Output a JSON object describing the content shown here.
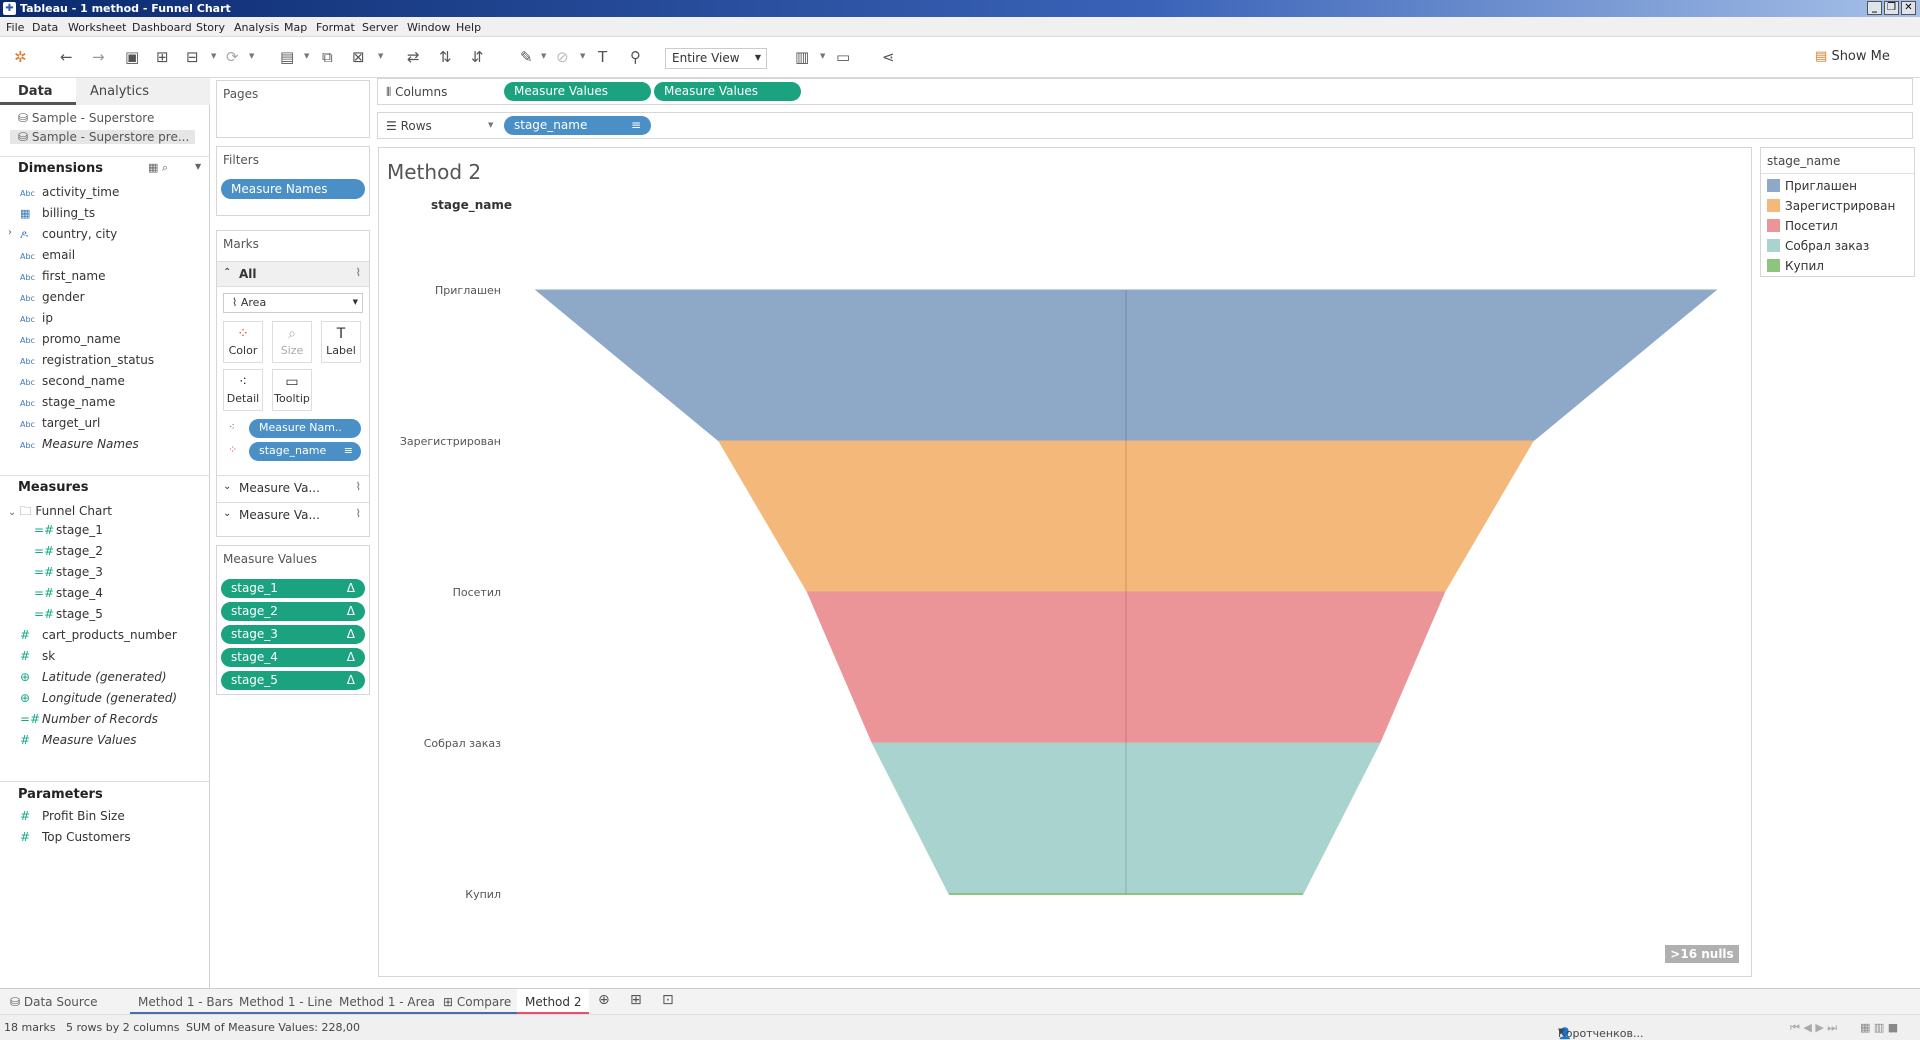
{
  "window": {
    "title": "Tableau - 1 method - Funnel Chart"
  },
  "menu": [
    "File",
    "Data",
    "Worksheet",
    "Dashboard",
    "Story",
    "Analysis",
    "Map",
    "Format",
    "Server",
    "Window",
    "Help"
  ],
  "toolbar": {
    "fit": "Entire View",
    "show_me": "Show Me"
  },
  "data_pane": {
    "tabs": [
      "Data",
      "Analytics"
    ],
    "datasources": [
      "Sample - Superstore",
      "Sample - Superstore pre..."
    ],
    "dimensions_title": "Dimensions",
    "dimensions": [
      "activity_time",
      "billing_ts",
      "country, city",
      "email",
      "first_name",
      "gender",
      "ip",
      "promo_name",
      "registration_status",
      "second_name",
      "stage_name",
      "target_url",
      "Measure Names"
    ],
    "measures_title": "Measures",
    "folder": "Funnel Chart",
    "folder_items": [
      "stage_1",
      "stage_2",
      "stage_3",
      "stage_4",
      "stage_5"
    ],
    "measures": [
      "cart_products_number",
      "sk",
      "Latitude (generated)",
      "Longitude (generated)",
      "Number of Records",
      "Measure Values"
    ],
    "parameters_title": "Parameters",
    "parameters": [
      "Profit Bin Size",
      "Top Customers"
    ]
  },
  "cards": {
    "pages": "Pages",
    "filters": "Filters",
    "filter_pill": "Measure Names",
    "marks": "Marks",
    "marks_all": "All",
    "mark_type": "Area",
    "mark_buttons": [
      "Color",
      "Size",
      "Label",
      "Detail",
      "Tooltip"
    ],
    "marks_pills": [
      "Measure Nam..",
      "stage_name"
    ],
    "sub_marks": [
      "Measure Va...",
      "Measure Va..."
    ],
    "measure_values_title": "Measure Values",
    "measure_values": [
      "stage_1",
      "stage_2",
      "stage_3",
      "stage_4",
      "stage_5"
    ]
  },
  "shelves": {
    "columns_label": "Columns",
    "columns": [
      "Measure Values",
      "Measure Values"
    ],
    "rows_label": "Rows",
    "rows": [
      "stage_name"
    ]
  },
  "view": {
    "title": "Method 2",
    "row_header": "stage_name",
    "nulls_badge": ">16 nulls"
  },
  "legend": {
    "title": "stage_name",
    "items": [
      {
        "label": "Приглашен",
        "color": "#8ea8c8"
      },
      {
        "label": "Зарегистрирован",
        "color": "#f4b87a"
      },
      {
        "label": "Посетил",
        "color": "#eb9598"
      },
      {
        "label": "Собрал заказ",
        "color": "#a9d3cf"
      },
      {
        "label": "Купил",
        "color": "#8fc47f"
      }
    ]
  },
  "chart_data": {
    "type": "area",
    "title": "Method 2",
    "categories": [
      "Приглашен",
      "Зарегистрирован",
      "Посетил",
      "Собрал заказ",
      "Купил"
    ],
    "series": [
      {
        "name": "Measure Values",
        "values": [
          100,
          69,
          54,
          43,
          30
        ]
      },
      {
        "name": "Measure Values",
        "values": [
          100,
          69,
          54,
          43,
          30
        ]
      }
    ],
    "colors": [
      "#8ea8c8",
      "#f4b87a",
      "#eb9598",
      "#a9d3cf",
      "#8fc47f"
    ],
    "xlim": [
      0,
      100
    ]
  },
  "sheet_tabs": [
    "Data Source",
    "Method 1 - Bars",
    "Method 1 - Line",
    "Method 1 - Area",
    "Compare",
    "Method 2"
  ],
  "status": {
    "marks": "18 marks",
    "rows_cols": "5 rows by 2 columns",
    "sum": "SUM of Measure Values: 228,00",
    "user": "Коротченков..."
  }
}
